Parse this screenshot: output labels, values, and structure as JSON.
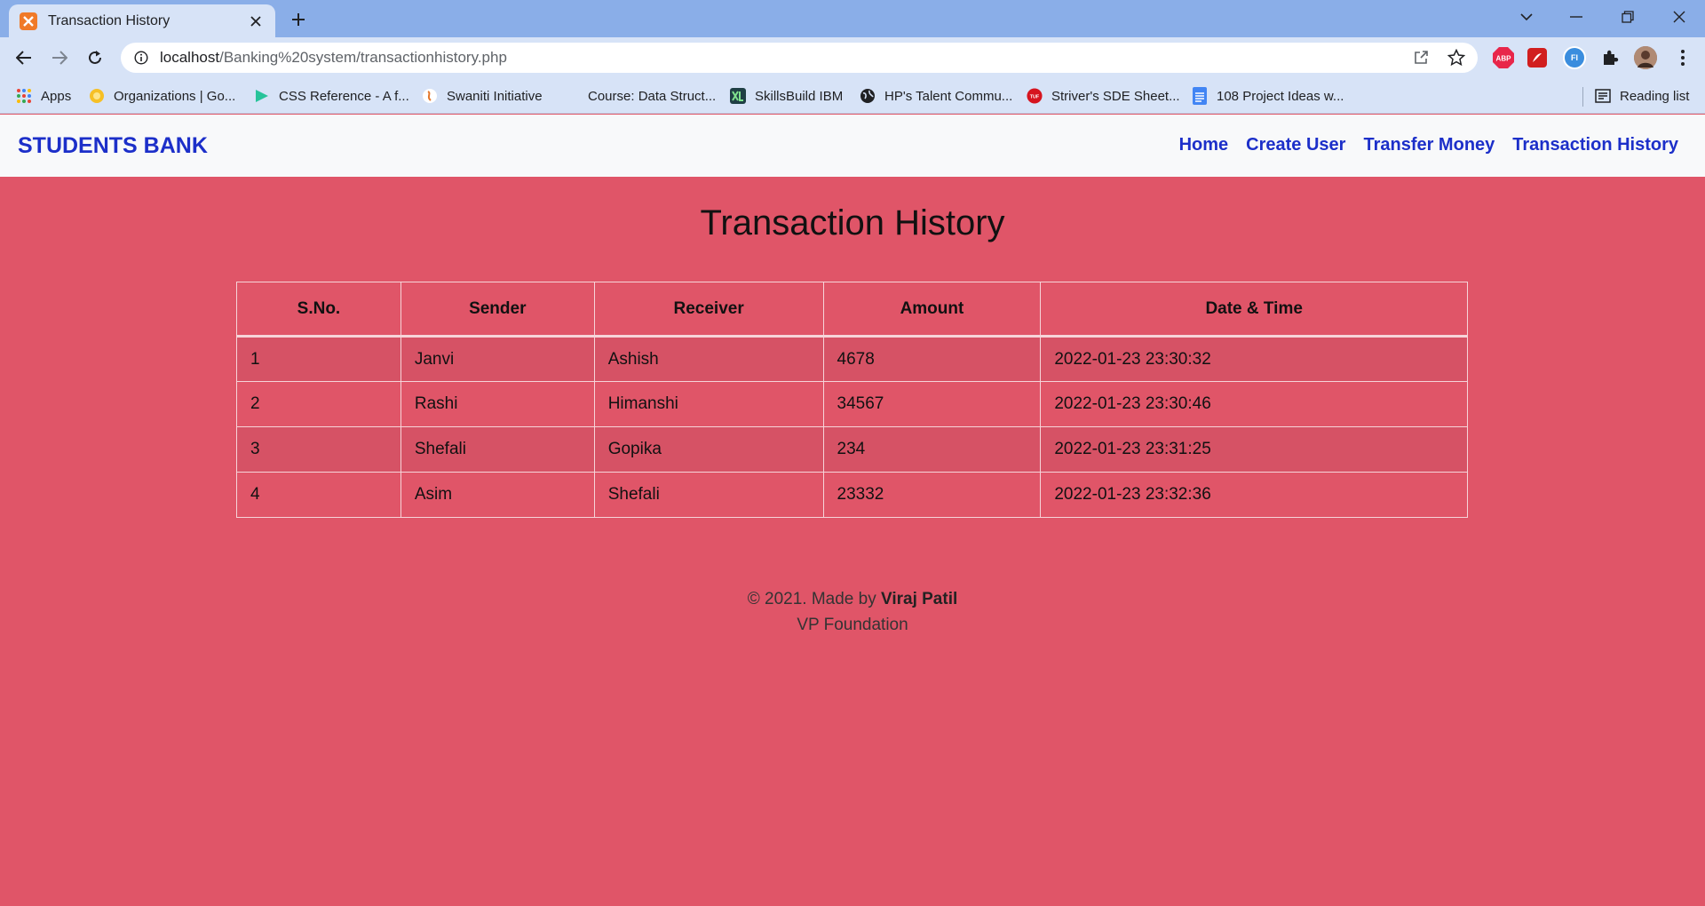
{
  "browser": {
    "tab_title": "Transaction History",
    "url_host": "localhost",
    "url_path": "/Banking%20system/transactionhistory.php",
    "bookmarks": [
      {
        "label": "Apps",
        "icon": "apps-grid-icon"
      },
      {
        "label": "Organizations | Go...",
        "icon": "org-icon"
      },
      {
        "label": "CSS Reference - A f...",
        "icon": "css-icon"
      },
      {
        "label": "Swaniti Initiative",
        "icon": "swaniti-icon"
      },
      {
        "label": "Course: Data Struct...",
        "icon": "course-icon"
      },
      {
        "label": "SkillsBuild IBM",
        "icon": "skillsbuild-icon"
      },
      {
        "label": "HP's Talent Commu...",
        "icon": "globe-icon"
      },
      {
        "label": "Striver's SDE Sheet...",
        "icon": "tuf-icon"
      },
      {
        "label": "108 Project Ideas w...",
        "icon": "docs-icon"
      }
    ],
    "reading_list": "Reading list",
    "extensions": [
      {
        "name": "adblock-icon",
        "text": "ABP",
        "color": "#e8264a"
      },
      {
        "name": "pdf-extension-icon",
        "text": "",
        "color": "#d11e1e"
      },
      {
        "name": "fi-extension-icon",
        "text": "FI",
        "color": "#3a8dde"
      }
    ]
  },
  "site": {
    "brand": "STUDENTS BANK",
    "nav": [
      "Home",
      "Create User",
      "Transfer Money",
      "Transaction History"
    ]
  },
  "main": {
    "title": "Transaction History",
    "table": {
      "headers": [
        "S.No.",
        "Sender",
        "Receiver",
        "Amount",
        "Date & Time"
      ],
      "rows": [
        [
          "1",
          "Janvi",
          "Ashish",
          "4678",
          "2022-01-23 23:30:32"
        ],
        [
          "2",
          "Rashi",
          "Himanshi",
          "34567",
          "2022-01-23 23:30:46"
        ],
        [
          "3",
          "Shefali",
          "Gopika",
          "234",
          "2022-01-23 23:31:25"
        ],
        [
          "4",
          "Asim",
          "Shefali",
          "23332",
          "2022-01-23 23:32:36"
        ]
      ]
    }
  },
  "footer": {
    "prefix": "© 2021. Made by ",
    "author": "Viraj Patil",
    "org": "VP Foundation"
  },
  "colors": {
    "page_bg": "#e05568",
    "row_alt": "#d65265",
    "brand": "#1c2fc9",
    "navbar_bg": "#f8f9fa"
  }
}
